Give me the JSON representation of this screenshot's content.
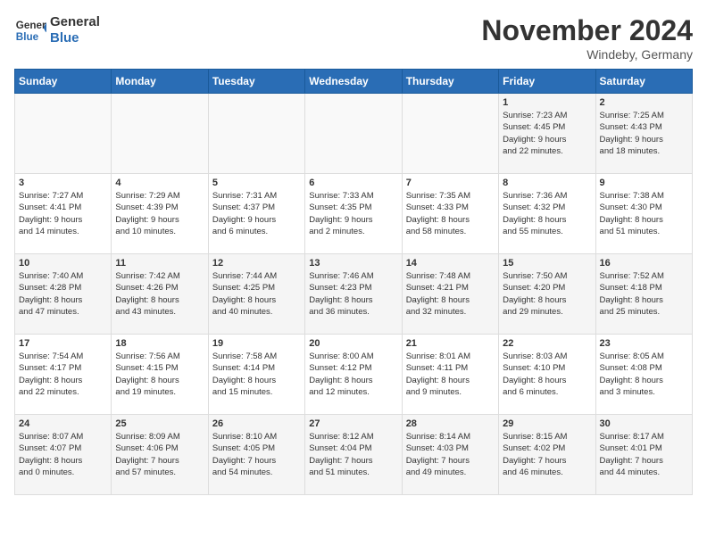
{
  "header": {
    "logo_line1": "General",
    "logo_line2": "Blue",
    "month": "November 2024",
    "location": "Windeby, Germany"
  },
  "weekdays": [
    "Sunday",
    "Monday",
    "Tuesday",
    "Wednesday",
    "Thursday",
    "Friday",
    "Saturday"
  ],
  "weeks": [
    [
      {
        "day": "",
        "info": ""
      },
      {
        "day": "",
        "info": ""
      },
      {
        "day": "",
        "info": ""
      },
      {
        "day": "",
        "info": ""
      },
      {
        "day": "",
        "info": ""
      },
      {
        "day": "1",
        "info": "Sunrise: 7:23 AM\nSunset: 4:45 PM\nDaylight: 9 hours\nand 22 minutes."
      },
      {
        "day": "2",
        "info": "Sunrise: 7:25 AM\nSunset: 4:43 PM\nDaylight: 9 hours\nand 18 minutes."
      }
    ],
    [
      {
        "day": "3",
        "info": "Sunrise: 7:27 AM\nSunset: 4:41 PM\nDaylight: 9 hours\nand 14 minutes."
      },
      {
        "day": "4",
        "info": "Sunrise: 7:29 AM\nSunset: 4:39 PM\nDaylight: 9 hours\nand 10 minutes."
      },
      {
        "day": "5",
        "info": "Sunrise: 7:31 AM\nSunset: 4:37 PM\nDaylight: 9 hours\nand 6 minutes."
      },
      {
        "day": "6",
        "info": "Sunrise: 7:33 AM\nSunset: 4:35 PM\nDaylight: 9 hours\nand 2 minutes."
      },
      {
        "day": "7",
        "info": "Sunrise: 7:35 AM\nSunset: 4:33 PM\nDaylight: 8 hours\nand 58 minutes."
      },
      {
        "day": "8",
        "info": "Sunrise: 7:36 AM\nSunset: 4:32 PM\nDaylight: 8 hours\nand 55 minutes."
      },
      {
        "day": "9",
        "info": "Sunrise: 7:38 AM\nSunset: 4:30 PM\nDaylight: 8 hours\nand 51 minutes."
      }
    ],
    [
      {
        "day": "10",
        "info": "Sunrise: 7:40 AM\nSunset: 4:28 PM\nDaylight: 8 hours\nand 47 minutes."
      },
      {
        "day": "11",
        "info": "Sunrise: 7:42 AM\nSunset: 4:26 PM\nDaylight: 8 hours\nand 43 minutes."
      },
      {
        "day": "12",
        "info": "Sunrise: 7:44 AM\nSunset: 4:25 PM\nDaylight: 8 hours\nand 40 minutes."
      },
      {
        "day": "13",
        "info": "Sunrise: 7:46 AM\nSunset: 4:23 PM\nDaylight: 8 hours\nand 36 minutes."
      },
      {
        "day": "14",
        "info": "Sunrise: 7:48 AM\nSunset: 4:21 PM\nDaylight: 8 hours\nand 32 minutes."
      },
      {
        "day": "15",
        "info": "Sunrise: 7:50 AM\nSunset: 4:20 PM\nDaylight: 8 hours\nand 29 minutes."
      },
      {
        "day": "16",
        "info": "Sunrise: 7:52 AM\nSunset: 4:18 PM\nDaylight: 8 hours\nand 25 minutes."
      }
    ],
    [
      {
        "day": "17",
        "info": "Sunrise: 7:54 AM\nSunset: 4:17 PM\nDaylight: 8 hours\nand 22 minutes."
      },
      {
        "day": "18",
        "info": "Sunrise: 7:56 AM\nSunset: 4:15 PM\nDaylight: 8 hours\nand 19 minutes."
      },
      {
        "day": "19",
        "info": "Sunrise: 7:58 AM\nSunset: 4:14 PM\nDaylight: 8 hours\nand 15 minutes."
      },
      {
        "day": "20",
        "info": "Sunrise: 8:00 AM\nSunset: 4:12 PM\nDaylight: 8 hours\nand 12 minutes."
      },
      {
        "day": "21",
        "info": "Sunrise: 8:01 AM\nSunset: 4:11 PM\nDaylight: 8 hours\nand 9 minutes."
      },
      {
        "day": "22",
        "info": "Sunrise: 8:03 AM\nSunset: 4:10 PM\nDaylight: 8 hours\nand 6 minutes."
      },
      {
        "day": "23",
        "info": "Sunrise: 8:05 AM\nSunset: 4:08 PM\nDaylight: 8 hours\nand 3 minutes."
      }
    ],
    [
      {
        "day": "24",
        "info": "Sunrise: 8:07 AM\nSunset: 4:07 PM\nDaylight: 8 hours\nand 0 minutes."
      },
      {
        "day": "25",
        "info": "Sunrise: 8:09 AM\nSunset: 4:06 PM\nDaylight: 7 hours\nand 57 minutes."
      },
      {
        "day": "26",
        "info": "Sunrise: 8:10 AM\nSunset: 4:05 PM\nDaylight: 7 hours\nand 54 minutes."
      },
      {
        "day": "27",
        "info": "Sunrise: 8:12 AM\nSunset: 4:04 PM\nDaylight: 7 hours\nand 51 minutes."
      },
      {
        "day": "28",
        "info": "Sunrise: 8:14 AM\nSunset: 4:03 PM\nDaylight: 7 hours\nand 49 minutes."
      },
      {
        "day": "29",
        "info": "Sunrise: 8:15 AM\nSunset: 4:02 PM\nDaylight: 7 hours\nand 46 minutes."
      },
      {
        "day": "30",
        "info": "Sunrise: 8:17 AM\nSunset: 4:01 PM\nDaylight: 7 hours\nand 44 minutes."
      }
    ]
  ]
}
